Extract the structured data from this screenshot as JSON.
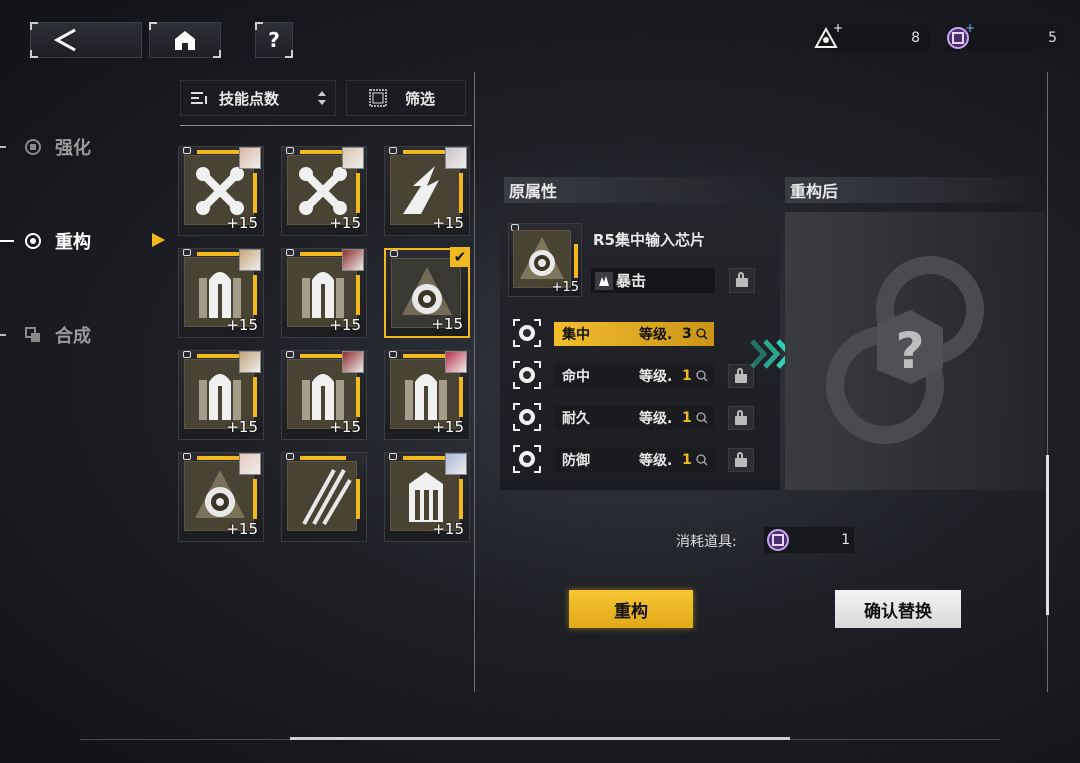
{
  "resources": [
    {
      "name": "upgrade-material",
      "value": "8"
    },
    {
      "name": "reconstruct-token",
      "value": "5"
    }
  ],
  "nav": {
    "items": [
      {
        "label": "强化"
      },
      {
        "label": "重构"
      },
      {
        "label": "合成"
      }
    ],
    "active": 1
  },
  "toolbar": {
    "sort_label": "技能点数",
    "filter_label": "筛选"
  },
  "chips": [
    {
      "icon": "wrench-icon",
      "bonus": "+15",
      "avatar": "#d9b8a6",
      "selected": false
    },
    {
      "icon": "wrench-icon",
      "bonus": "+15",
      "avatar": "#d8c6b0",
      "selected": false
    },
    {
      "icon": "claw-icon",
      "bonus": "+15",
      "avatar": "#c9c4c8",
      "selected": false
    },
    {
      "icon": "tower-icon",
      "bonus": "+15",
      "avatar": "#c2a77a",
      "selected": false
    },
    {
      "icon": "tower-icon",
      "bonus": "+15",
      "avatar": "#8a2d2d",
      "selected": false
    },
    {
      "icon": "target-icon",
      "bonus": "+15",
      "avatar": "",
      "selected": true
    },
    {
      "icon": "tower-icon",
      "bonus": "+15",
      "avatar": "#c2a77a",
      "selected": false
    },
    {
      "icon": "tower-icon",
      "bonus": "+15",
      "avatar": "#8a2d2d",
      "selected": false
    },
    {
      "icon": "tower-icon",
      "bonus": "+15",
      "avatar": "#b8324a",
      "selected": false
    },
    {
      "icon": "target-icon",
      "bonus": "+15",
      "avatar": "#e7c7c0",
      "selected": false
    },
    {
      "icon": "slash-icon",
      "bonus": "",
      "avatar": "",
      "selected": false
    },
    {
      "icon": "shield-gate-icon",
      "bonus": "+15",
      "avatar": "#aab8d8",
      "selected": false
    }
  ],
  "original": {
    "header": "原属性",
    "chip_name": "R5集中输入芯片",
    "chip_bonus": "+15",
    "skill": "暴击",
    "stats": [
      {
        "name": "集中",
        "level_label": "等级.",
        "level": "3",
        "active": true
      },
      {
        "name": "命中",
        "level_label": "等级.",
        "level": "1",
        "active": false
      },
      {
        "name": "耐久",
        "level_label": "等级.",
        "level": "1",
        "active": false
      },
      {
        "name": "防御",
        "level_label": "等级.",
        "level": "1",
        "active": false
      }
    ]
  },
  "result": {
    "header": "重构后",
    "placeholder": "?"
  },
  "cost": {
    "label": "消耗道具:",
    "value": "1"
  },
  "actions": {
    "reconstruct_label": "重构",
    "confirm_label": "确认替换"
  },
  "colors": {
    "accent": "#f1b91f",
    "arrow": "#2fd3b5"
  }
}
